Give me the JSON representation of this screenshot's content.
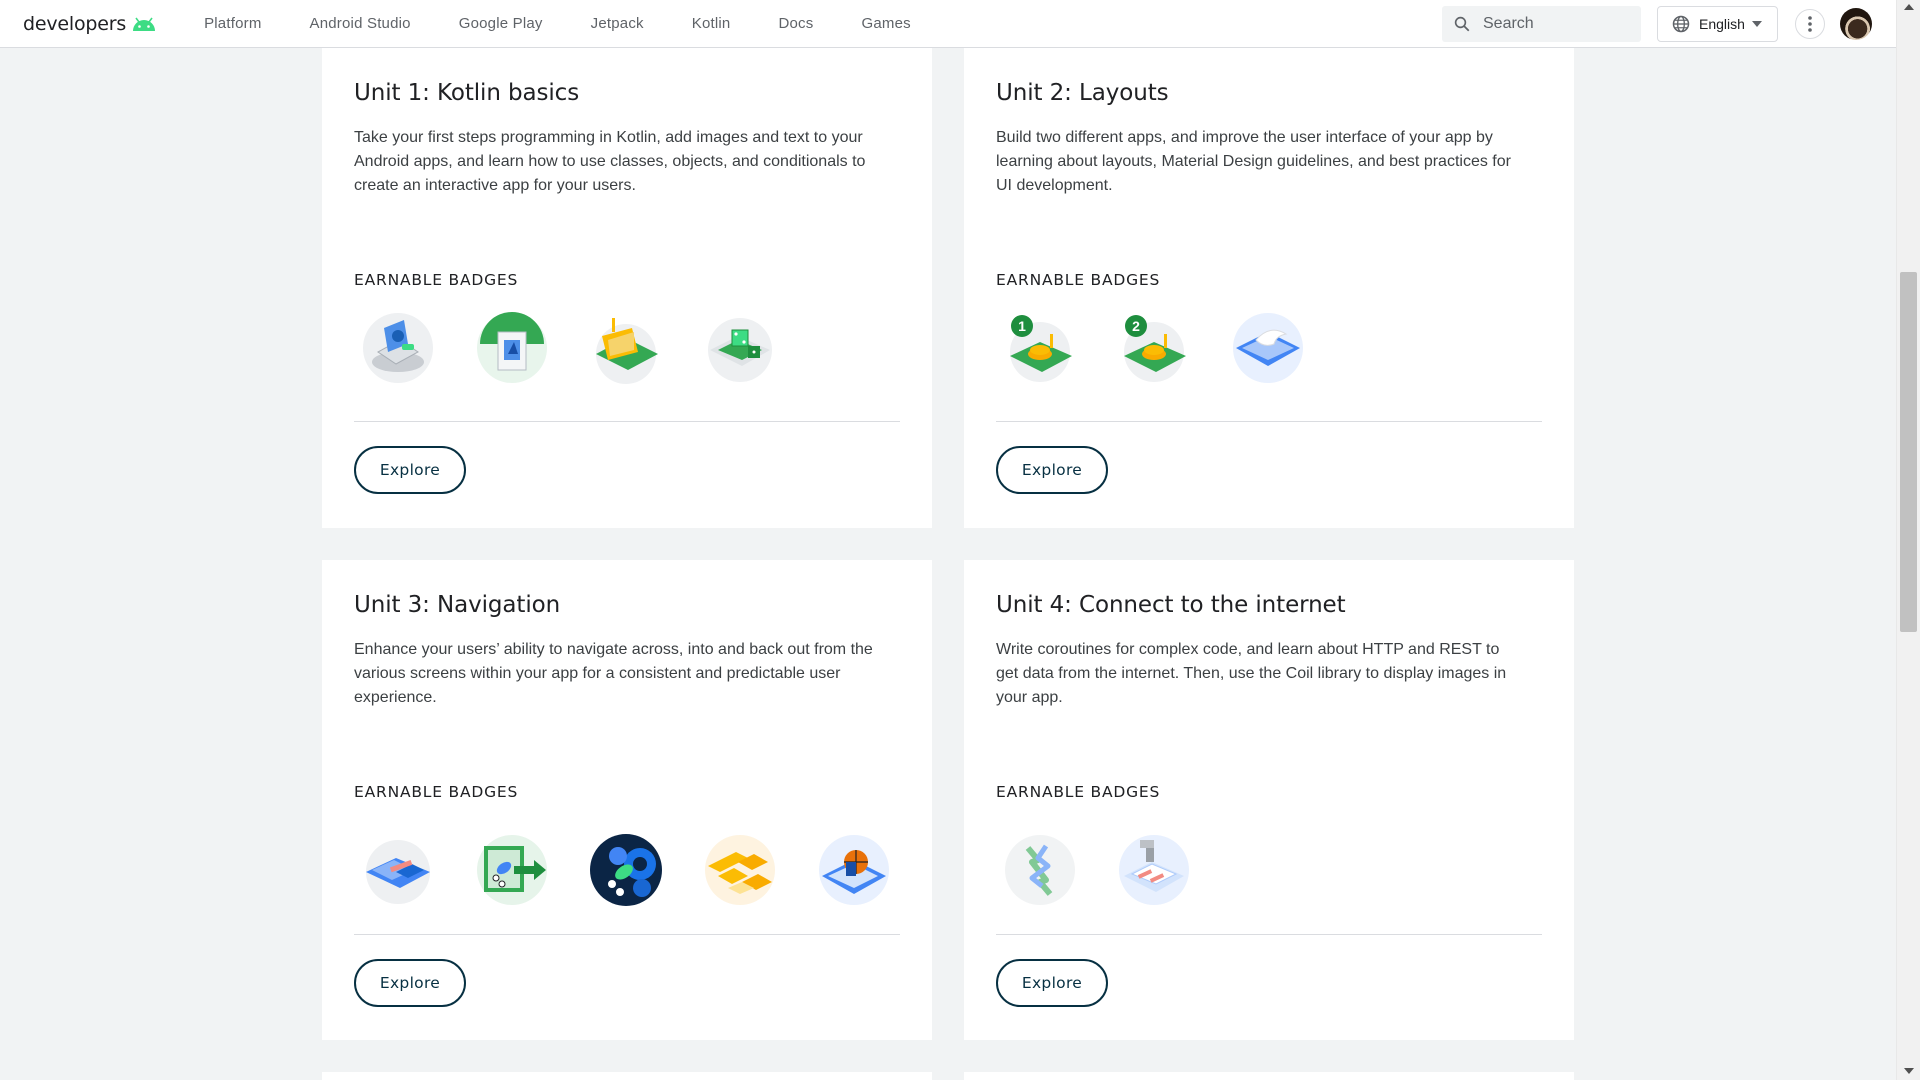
{
  "header": {
    "logo_text": "developers",
    "nav": [
      "Platform",
      "Android Studio",
      "Google Play",
      "Jetpack",
      "Kotlin",
      "Docs",
      "Games"
    ],
    "search_placeholder": "Search",
    "language": "English"
  },
  "units": [
    {
      "title": "Unit 1: Kotlin basics",
      "description": "Take your first steps programming in Kotlin, add images and text to your Android apps, and learn how to use classes, objects, and conditionals to create an interactive app for your users.",
      "badges_label": "EARNABLE BADGES",
      "button": "Explore",
      "badges": [
        "laptop-android-badge",
        "code-editor-badge",
        "envelope-card-badge",
        "dice-roll-badge"
      ]
    },
    {
      "title": "Unit 2: Layouts",
      "description": "Build two different apps, and improve the user interface of your app by learning about layouts, Material Design guidelines, and best practices for UI development.",
      "badges_label": "EARNABLE BADGES",
      "button": "Explore",
      "badges": [
        "tip-calculator-badge-1",
        "tip-calculator-badge-2",
        "dove-material-badge"
      ],
      "badge_numbers": [
        "1",
        "2"
      ]
    },
    {
      "title": "Unit 3: Navigation",
      "description": "Enhance your users’ ability to navigate across, into and back out from the various screens within your app for a consistent and predictable user experience.",
      "badges_label": "EARNABLE BADGES",
      "button": "Explore",
      "badges": [
        "blue-screens-badge",
        "navigation-arrow-badge",
        "gear-android-badge",
        "orange-tiles-badge",
        "basketball-badge"
      ]
    },
    {
      "title": "Unit 4: Connect to the internet",
      "description": "Write coroutines for complex code, and learn about HTTP and REST to get data from the internet. Then, use the Coil library to display images in your app.",
      "badges_label": "EARNABLE BADGES",
      "button": "Explore",
      "badges": [
        "coroutines-arrows-badge",
        "internet-data-badge"
      ]
    }
  ],
  "colors": {
    "android_green": "#3ddc84",
    "button_border": "#073042",
    "page_bg": "#f1f3f4"
  }
}
